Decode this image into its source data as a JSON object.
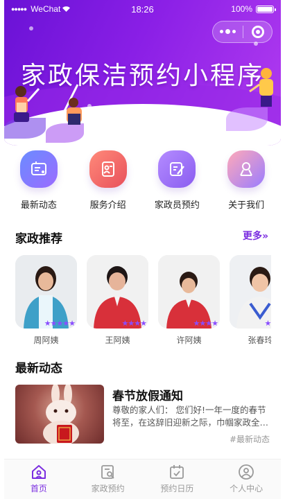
{
  "status_bar": {
    "carrier": "WeChat",
    "time": "18:26",
    "battery": "100%"
  },
  "banner": {
    "title": "家政保洁预约小程序"
  },
  "quick_nav": [
    {
      "label": "最新动态",
      "icon": "news-icon",
      "color_from": "#6a8cff",
      "color_to": "#9b6bff"
    },
    {
      "label": "服务介绍",
      "icon": "service-icon",
      "color_from": "#ff8a7a",
      "color_to": "#e8505b"
    },
    {
      "label": "家政员预约",
      "icon": "booking-icon",
      "color_from": "#b48cff",
      "color_to": "#8a5cf0"
    },
    {
      "label": "关于我们",
      "icon": "about-icon",
      "color_from": "#ffa9b8",
      "color_to": "#9a7cff"
    }
  ],
  "recommend": {
    "title": "家政推荐",
    "more": "更多»",
    "staff": [
      {
        "name": "周阿姨",
        "stars": "★★★★★",
        "outfit": "#3ea0c8"
      },
      {
        "name": "王阿姨",
        "stars": "★★★★",
        "outfit": "#d8303a"
      },
      {
        "name": "许阿姨",
        "stars": "★★★★",
        "outfit": "#d8303a"
      },
      {
        "name": "张春玲",
        "stars": "★★★★",
        "outfit": "#f2f2f2"
      }
    ]
  },
  "news": {
    "title": "最新动态",
    "items": [
      {
        "title": "春节放假通知",
        "excerpt": "尊敬的家人们： 您们好!一年一度的春节将至，在这辞旧迎新之际，巾帼家政全体员工祝大家新春快乐",
        "tag": "#最新动态"
      }
    ]
  },
  "tabbar": [
    {
      "label": "首页",
      "icon": "home-icon",
      "active": true
    },
    {
      "label": "家政预约",
      "icon": "booking-search-icon",
      "active": false
    },
    {
      "label": "预约日历",
      "icon": "calendar-icon",
      "active": false
    },
    {
      "label": "个人中心",
      "icon": "user-icon",
      "active": false
    }
  ],
  "colors": {
    "accent": "#7b2ee0",
    "banner_from": "#6a12d6",
    "banner_to": "#b23cf0"
  }
}
